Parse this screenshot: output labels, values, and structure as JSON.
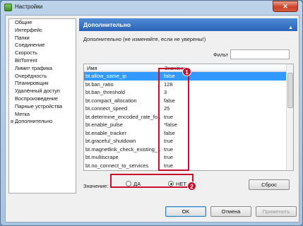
{
  "window": {
    "title": "Настройки",
    "close_glyph": "✕"
  },
  "sidebar": {
    "items": [
      {
        "label": "Общие"
      },
      {
        "label": "Интерфейс"
      },
      {
        "label": "Папки"
      },
      {
        "label": "Соединение"
      },
      {
        "label": "Скорость"
      },
      {
        "label": "BitTorrent"
      },
      {
        "label": "Лимит трафика"
      },
      {
        "label": "Очерёдность"
      },
      {
        "label": "Планировщик"
      },
      {
        "label": "Удалённый доступ"
      },
      {
        "label": "Воспроизведение"
      },
      {
        "label": "Парные устройства"
      },
      {
        "label": "Метка"
      },
      {
        "label": "Дополнительно",
        "expander": "⊞"
      }
    ]
  },
  "panel": {
    "title": "Дополнительно",
    "collapse_glyph": "▲",
    "description": "Дополнительно (не изменяйте, если не уверены!)",
    "filter_label": "Фильт",
    "filter_value": ""
  },
  "table": {
    "headers": {
      "name": "Имя",
      "value": "Значение"
    },
    "rows": [
      {
        "name": "bt.allow_same_ip",
        "value": "false",
        "selected": true
      },
      {
        "name": "bt.ban_ratio",
        "value": "128"
      },
      {
        "name": "bt.ban_threshold",
        "value": "3"
      },
      {
        "name": "bt.compact_allocation",
        "value": "false"
      },
      {
        "name": "bt.connect_speed",
        "value": "25"
      },
      {
        "name": "bt.determine_encoded_rate_fo...",
        "value": "true"
      },
      {
        "name": "bt.enable_pulse",
        "value": "*false"
      },
      {
        "name": "bt.enable_tracker",
        "value": "false"
      },
      {
        "name": "bt.graceful_shutdown",
        "value": "true"
      },
      {
        "name": "bt.magnetlink_check_existing_...",
        "value": "true"
      },
      {
        "name": "bt.multiscrape",
        "value": "true"
      },
      {
        "name": "bt.no_connect_to_services",
        "value": "true"
      }
    ]
  },
  "value_editor": {
    "label": "Значение:",
    "options": [
      {
        "label": "ДА",
        "checked": false
      },
      {
        "label": "НЕТ",
        "checked": true
      }
    ],
    "reset_label": "Сброс"
  },
  "footer": {
    "ok_label": "OK",
    "cancel_label": "Отмена",
    "apply_label": "Применить"
  },
  "annotations": {
    "badge_1": "1",
    "badge_2": "2",
    "color": "#c8102e"
  },
  "colors": {
    "header_blue": "#2c64b8",
    "selection": "#3399ff"
  }
}
